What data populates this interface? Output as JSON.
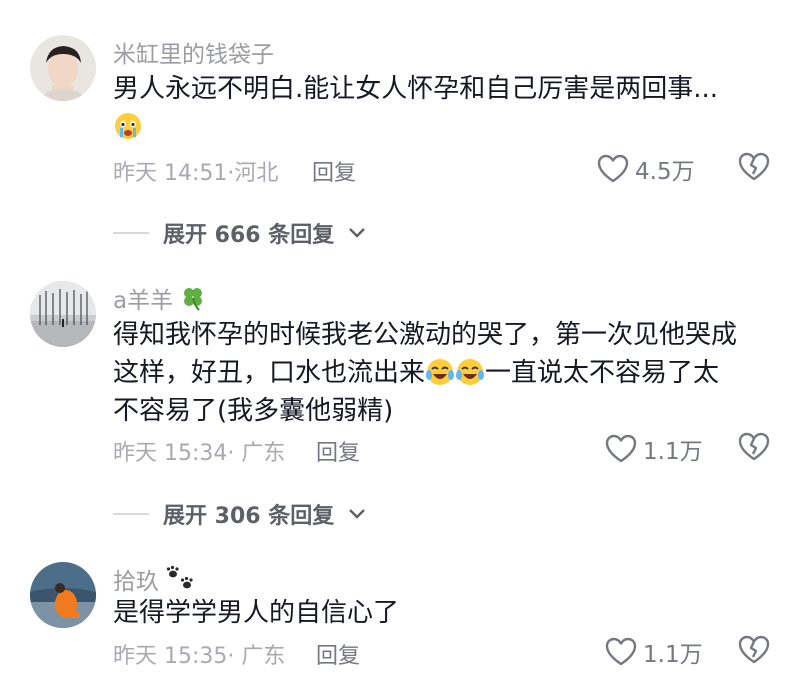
{
  "comments": [
    {
      "username": "米缸里的钱袋子",
      "text": "男人永远不明白.能让女人怀孕和自己厉害是两回事...",
      "time_location": "昨天 14:51·河北",
      "reply_label": "回复",
      "likes": "4.5万",
      "emojis": [
        "crying-face"
      ],
      "expand_label": "展开 666 条回复"
    },
    {
      "username": "a羊羊",
      "username_badge": "clover-emoji",
      "text_line1": "得知我怀孕的时候我老公激动的哭了，第一次见他哭成",
      "text_line2a": "这样，好丑，口水也流出来",
      "text_line2b": "一直说太不容易了太",
      "text_line3": "不容易了(我多囊他弱精)",
      "emojis": [
        "tears-of-joy",
        "tears-of-joy"
      ],
      "time_location": "昨天 15:34· 广东",
      "reply_label": "回复",
      "likes": "1.1万",
      "expand_label": "展开 306 条回复"
    },
    {
      "username": "拾玖",
      "username_badge": "paw-prints-emoji",
      "text": "是得学学男人的自信心了",
      "time_location": "昨天 15:35· 广东",
      "reply_label": "回复",
      "likes": "1.1万"
    }
  ]
}
